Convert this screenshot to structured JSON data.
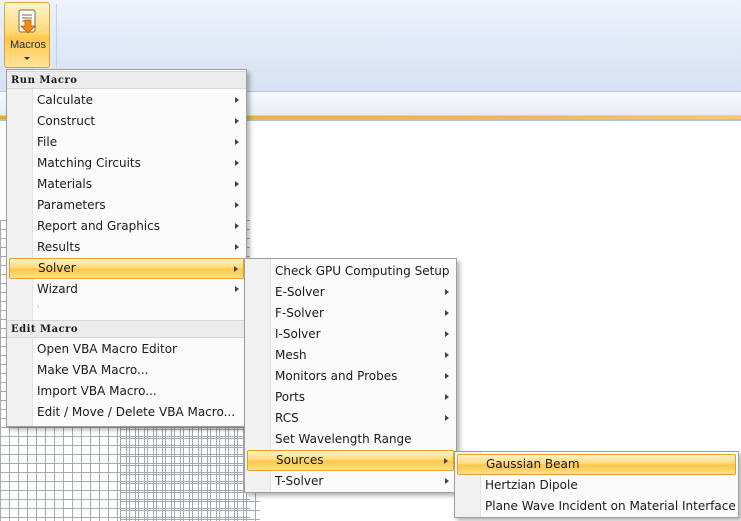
{
  "ribbon": {
    "macros_label": "Macros",
    "icons": {
      "macros": "scroll-down-arrow-icon",
      "dropdown": "chevron-down-icon"
    }
  },
  "main_menu": {
    "run_header": "Run Macro",
    "run_items": [
      {
        "label": "Calculate",
        "submenu": true
      },
      {
        "label": "Construct",
        "submenu": true
      },
      {
        "label": "File",
        "submenu": true
      },
      {
        "label": "Matching Circuits",
        "submenu": true
      },
      {
        "label": "Materials",
        "submenu": true
      },
      {
        "label": "Parameters",
        "submenu": true
      },
      {
        "label": "Report and Graphics",
        "submenu": true
      },
      {
        "label": "Results",
        "submenu": true
      },
      {
        "label": "Solver",
        "submenu": true,
        "highlighted": true
      },
      {
        "label": "Wizard",
        "submenu": true
      },
      {
        "label": "'",
        "submenu": false
      }
    ],
    "edit_header": "Edit Macro",
    "edit_items": [
      {
        "label": "Open VBA Macro Editor"
      },
      {
        "label": "Make VBA Macro..."
      },
      {
        "label": "Import VBA Macro..."
      },
      {
        "label": "Edit / Move / Delete VBA Macro..."
      }
    ]
  },
  "solver_menu": {
    "items": [
      {
        "label": "Check GPU Computing Setup",
        "submenu": false
      },
      {
        "label": "E-Solver",
        "submenu": true
      },
      {
        "label": "F-Solver",
        "submenu": true
      },
      {
        "label": "I-Solver",
        "submenu": true
      },
      {
        "label": "Mesh",
        "submenu": true
      },
      {
        "label": "Monitors and Probes",
        "submenu": true
      },
      {
        "label": "Ports",
        "submenu": true
      },
      {
        "label": "RCS",
        "submenu": true
      },
      {
        "label": "Set Wavelength Range",
        "submenu": false
      },
      {
        "label": "Sources",
        "submenu": true,
        "highlighted": true
      },
      {
        "label": "T-Solver",
        "submenu": true
      }
    ]
  },
  "sources_menu": {
    "items": [
      {
        "label": "Gaussian Beam",
        "highlighted": true
      },
      {
        "label": "Hertzian Dipole"
      },
      {
        "label": "Plane Wave Incident on Material Interface"
      }
    ]
  },
  "colors": {
    "highlight_top": "#fff2c3",
    "highlight_bottom": "#ffc543",
    "highlight_border": "#e2a12a",
    "accent_orange": "#f4a33a"
  }
}
